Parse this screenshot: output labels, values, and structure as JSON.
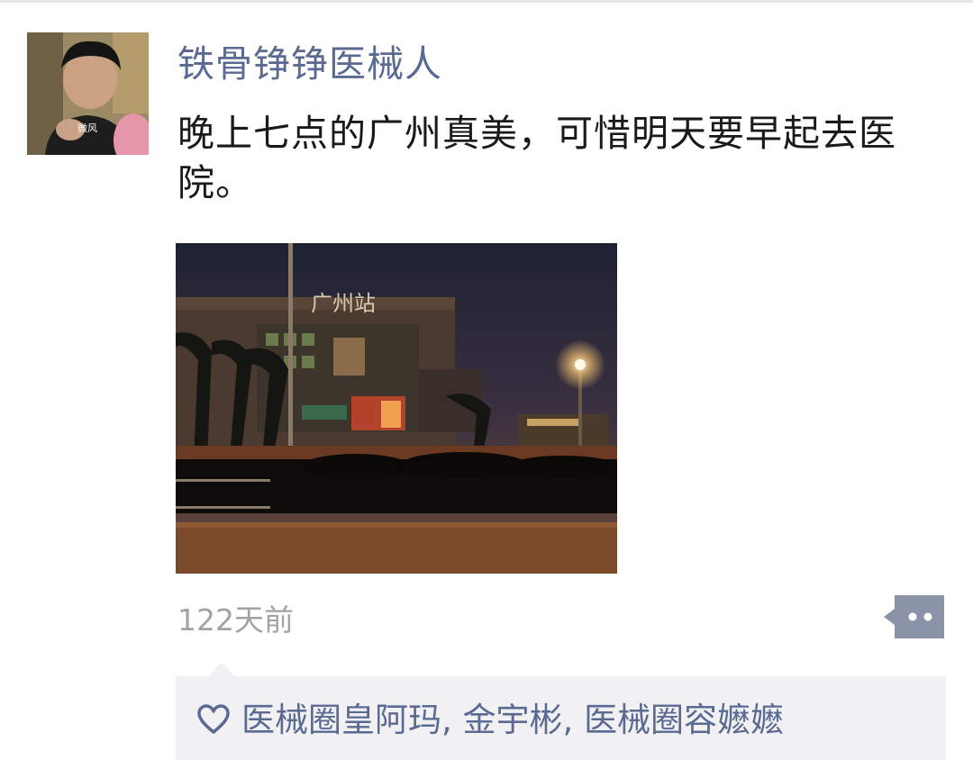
{
  "post": {
    "author_name": "铁骨铮铮医械人",
    "text": "晚上七点的广州真美，可惜明天要早起去医院。",
    "timestamp": "122天前",
    "photo_sign_text": "广州站",
    "avatar_watermark": "微风"
  },
  "likes": {
    "icon": "heart-outline-icon",
    "names": [
      "医械圈皇阿玛",
      "金宇彬",
      "医械圈容嬷嬷"
    ],
    "separator": ", "
  },
  "comment_button": {
    "icon": "comment-dots-icon"
  },
  "colors": {
    "name_link": "#5b6a93",
    "timestamp": "#a3a3a3",
    "likes_bg": "#f1f1f3",
    "comment_button": "#8b93a8"
  }
}
